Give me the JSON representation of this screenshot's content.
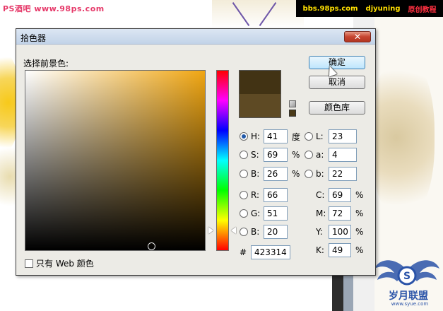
{
  "background": {
    "watermark_left": "PS酒吧 www.98ps.com",
    "banner": [
      "bbs.98ps.com",
      "djyuning",
      "原创教程"
    ],
    "logo_text": "岁月联盟",
    "logo_sub": "www.syue.com"
  },
  "dialog": {
    "title": "拾色器",
    "close_icon": "✕",
    "select_label": "选择前景色:",
    "buttons": {
      "ok": "确定",
      "cancel": "取消",
      "library": "颜色库"
    },
    "hsb": [
      {
        "label": "H:",
        "value": "41",
        "unit": "度",
        "selected": true
      },
      {
        "label": "S:",
        "value": "69",
        "unit": "%",
        "selected": false
      },
      {
        "label": "B:",
        "value": "26",
        "unit": "%",
        "selected": false
      }
    ],
    "rgb": [
      {
        "label": "R:",
        "value": "66"
      },
      {
        "label": "G:",
        "value": "51"
      },
      {
        "label": "B:",
        "value": "20"
      }
    ],
    "lab": [
      {
        "label": "L:",
        "value": "23"
      },
      {
        "label": "a:",
        "value": "4"
      },
      {
        "label": "b:",
        "value": "22"
      }
    ],
    "cmyk": [
      {
        "label": "C:",
        "value": "69",
        "unit": "%"
      },
      {
        "label": "M:",
        "value": "72",
        "unit": "%"
      },
      {
        "label": "Y:",
        "value": "100",
        "unit": "%"
      },
      {
        "label": "K:",
        "value": "49",
        "unit": "%"
      }
    ],
    "hex_label": "#",
    "hex_value": "423314",
    "web_only_label": "只有 Web 颜色",
    "new_color": "#423314",
    "current_color": "#5e4a24",
    "hue_color": "#f0a612"
  }
}
